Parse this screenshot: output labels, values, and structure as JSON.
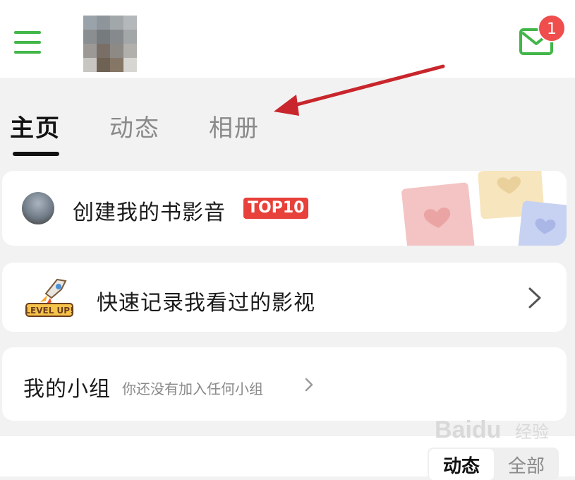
{
  "header": {
    "menu_icon": "hamburger-menu-icon",
    "mail_icon": "envelope-icon",
    "mail_badge": "1",
    "accent_color": "#42b649",
    "badge_color": "#f04d4d"
  },
  "tabs": [
    {
      "label": "主页",
      "active": true
    },
    {
      "label": "动态",
      "active": false
    },
    {
      "label": "相册",
      "active": false
    }
  ],
  "cards": {
    "collection": {
      "title": "创建我的书影音",
      "badge": "TOP10",
      "badge_color": "#e8403a"
    },
    "quick_record": {
      "title": "快速记录我看过的影视",
      "icon_text": "LEVEL UP!"
    },
    "groups": {
      "title": "我的小组",
      "subtitle": "你还没有加入任何小组"
    }
  },
  "feed_filter": {
    "options": [
      "动态",
      "全部"
    ],
    "selected": "动态"
  },
  "watermark": {
    "brand": "Baidu",
    "suffix": "经验"
  },
  "annotation_color": "#c8262c"
}
